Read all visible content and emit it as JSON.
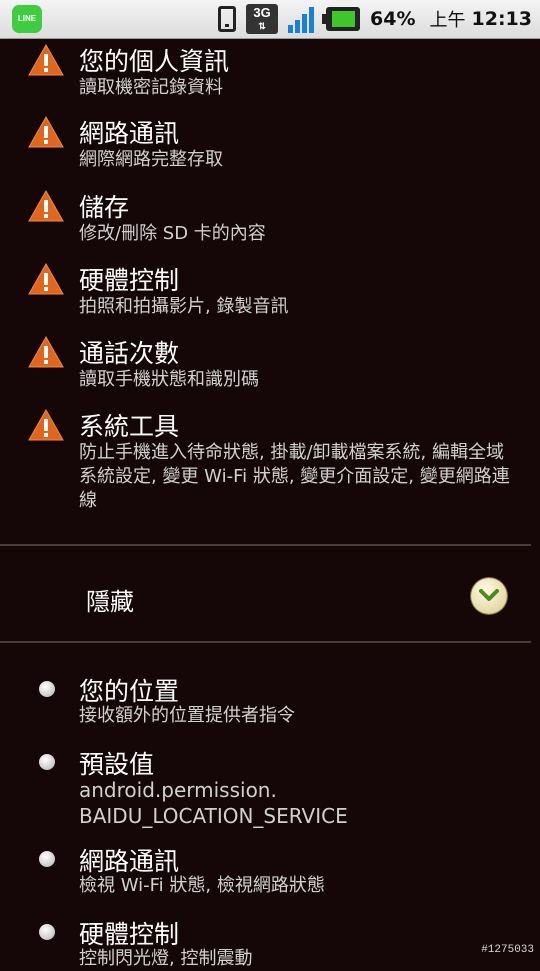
{
  "status_bar": {
    "app_icon_label": "LINE",
    "network_label": "3G",
    "battery_percent": "64%",
    "time_prefix": "上午",
    "time": "12:13"
  },
  "permissions": [
    {
      "title": "您的個人資訊",
      "desc": "讀取機密記錄資料"
    },
    {
      "title": "網路通訊",
      "desc": "網際網路完整存取"
    },
    {
      "title": "儲存",
      "desc": "修改/刪除 SD 卡的內容"
    },
    {
      "title": "硬體控制",
      "desc": "拍照和拍攝影片, 錄製音訊"
    },
    {
      "title": "通話次數",
      "desc": "讀取手機狀態和識別碼"
    },
    {
      "title": "系統工具",
      "desc": "防止手機進入待命狀態, 掛載/卸載檔案系統, 編輯全域系統設定, 變更 Wi-Fi 狀態, 變更介面設定, 變更網路連線"
    }
  ],
  "hidden_section": {
    "label": "隱藏"
  },
  "hidden_permissions": [
    {
      "title": "您的位置",
      "desc": "接收額外的位置提供者指令"
    },
    {
      "title": "預設值",
      "desc_line1": "android.permission.",
      "desc_line2": "BAIDU_LOCATION_SERVICE"
    },
    {
      "title": "網路通訊",
      "desc": "檢視 Wi-Fi 狀態, 檢視網路狀態"
    },
    {
      "title": "硬體控制",
      "desc": "控制閃光燈, 控制震動"
    }
  ],
  "watermark": "#1275033",
  "colors": {
    "background": "#150708",
    "warning_orange": "#e0661e",
    "divider": "#4a3a3a"
  }
}
